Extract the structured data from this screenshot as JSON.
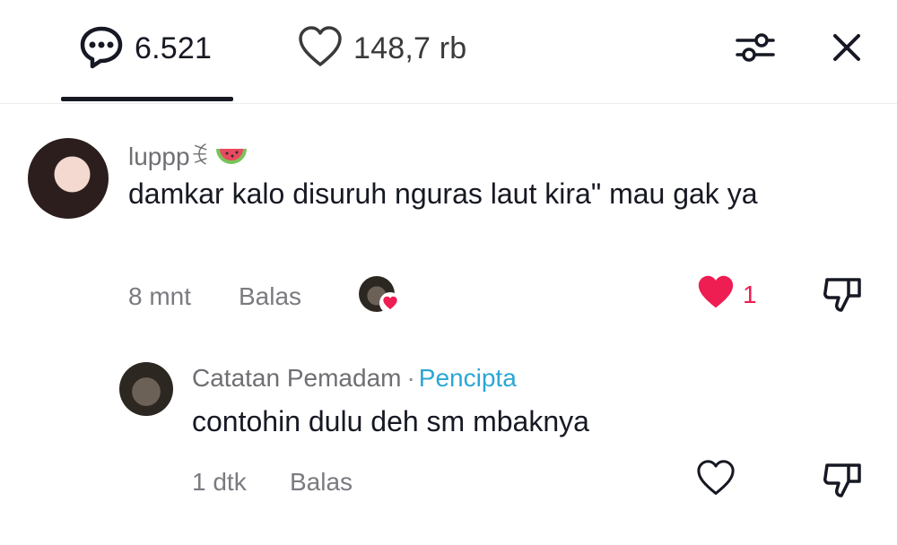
{
  "header": {
    "comments_count": "6.521",
    "likes_count": "148,7 rb",
    "icons": {
      "comments": "comment-bubble-icon",
      "likes": "heart-outline-icon",
      "filter": "filter-sliders-icon",
      "close": "close-icon"
    }
  },
  "comments": [
    {
      "username": "lupppꉂ",
      "text": "damkar kalo disuruh nguras laut kira\" mau gak ya",
      "time": "8 mnt",
      "reply_label": "Balas",
      "likes": "1",
      "liked": true,
      "creator_liked": true
    }
  ],
  "replies": [
    {
      "username": "Catatan Pemadam",
      "separator": "·",
      "creator_label": "Pencipta",
      "text": "contohin dulu deh sm mbaknya",
      "time": "1 dtk",
      "reply_label": "Balas",
      "liked": false
    }
  ],
  "colors": {
    "heart_red": "#ee1d52",
    "creator_blue": "#2aa7d6",
    "text_gray": "#7a7a80"
  }
}
